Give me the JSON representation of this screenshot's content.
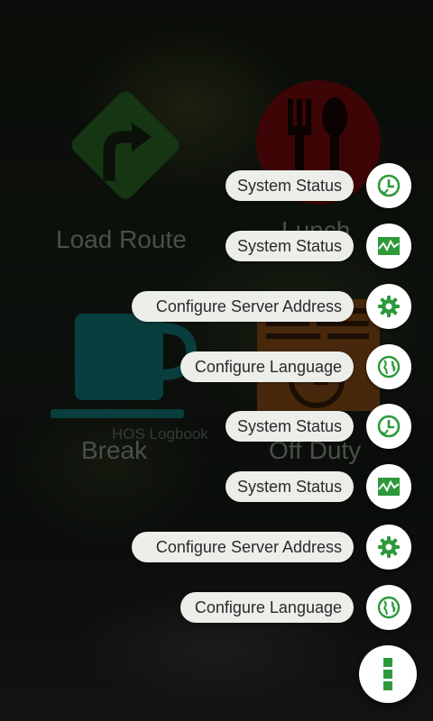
{
  "colors": {
    "accent_green": "#2d9a3a",
    "chip_background": "#eceeea",
    "load_route_tile": "#1f4f1c",
    "lunch_tile": "#5a0808",
    "break_tile": "#0d5c5c",
    "off_duty_tile": "#6b3c12"
  },
  "dashboard": {
    "load_route": {
      "label": "Load Route",
      "icon": "turn-right-sign-icon"
    },
    "lunch": {
      "label": "Lunch",
      "icon": "fork-spoon-icon"
    },
    "break": {
      "label": "Break",
      "icon": "coffee-cup-icon"
    },
    "off_duty": {
      "label": "Off Duty",
      "icon": "logbook-icon"
    },
    "hos_logbook_label": "HOS Logbook"
  },
  "fab_menu": {
    "items": [
      {
        "label": "System Status",
        "icon": "clock-check-icon"
      },
      {
        "label": "System Status",
        "icon": "pulse-chart-icon"
      },
      {
        "label": "Configure Server Address",
        "icon": "gear-icon"
      },
      {
        "label": "Configure Language",
        "icon": "globe-icon"
      },
      {
        "label": "System Status",
        "icon": "clock-check-icon"
      },
      {
        "label": "System Status",
        "icon": "pulse-chart-icon"
      },
      {
        "label": "Configure Server Address",
        "icon": "gear-icon"
      },
      {
        "label": "Configure Language",
        "icon": "globe-icon"
      }
    ],
    "main_fab_icon": "more-vertical-icon"
  }
}
